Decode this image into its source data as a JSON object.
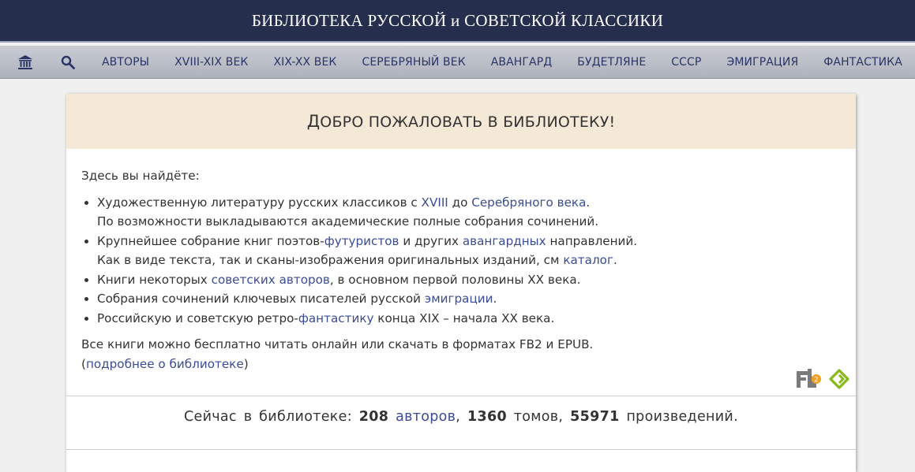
{
  "header": {
    "title": "БИБЛИОТЕКА РУССКОЙ и СОВЕТСКОЙ КЛАССИКИ"
  },
  "nav": {
    "home_icon": "library-building-icon",
    "search_icon": "search-icon",
    "items": [
      {
        "label": "АВТОРЫ"
      },
      {
        "label": "XVIII-XIX ВЕК"
      },
      {
        "label": "XIX-XX ВЕК"
      },
      {
        "label": "СЕРЕБРЯНЫЙ ВЕК"
      },
      {
        "label": "АВАНГАРД"
      },
      {
        "label": "БУДЕТЛЯНЕ"
      },
      {
        "label": "СССР"
      },
      {
        "label": "ЭМИГРАЦИЯ"
      },
      {
        "label": "ФАНТАСТИКА"
      }
    ]
  },
  "welcome": {
    "title_first": "Д",
    "title_rest": "ОБРО ПОЖАЛОВАТЬ В БИБЛИОТЕКУ!"
  },
  "intro": "Здесь вы найдёте:",
  "list": {
    "item1": {
      "a": "Художественную литературу русских классиков с ",
      "link1": "XVIII",
      "b": " до ",
      "link2": "Серебряного века",
      "c": ".",
      "line2": "По возможности выкладываются академические полные собрания сочинений."
    },
    "item2": {
      "a": "Крупнейшее собрание книг поэтов-",
      "link1": "футуристов",
      "b": " и других ",
      "link2": "авангардных",
      "c": " направлений.",
      "line2a": "Как в виде текста, так и сканы-изображения оригинальных изданий, см ",
      "link3": "каталог",
      "line2b": "."
    },
    "item3": {
      "a": "Книги некоторых ",
      "link1": "советских авторов",
      "b": ", в основном первой половины XX века."
    },
    "item4": {
      "a": "Собрания сочинений ключевых писателей русской ",
      "link1": "эмиграции",
      "b": "."
    },
    "item5": {
      "a": "Российскую и советскую ретро-",
      "link1": "фантастику",
      "b": " конца XIX – начала XX века."
    }
  },
  "footer_text": {
    "line1": "Все книги можно бесплатно читать онлайн или скачать в форматах FB2 и EPUB.",
    "open": "(",
    "link": "подробнее о библиотеке",
    "close": ")"
  },
  "formats": {
    "fb2_icon": "fb2-format-icon",
    "epub_icon": "epub-format-icon"
  },
  "stats": {
    "prefix": "Сейчас в библиотеке:",
    "authors_count": "208",
    "authors_link": "авторов",
    "sep1": ",",
    "volumes_count": "1360",
    "volumes_label": "томов,",
    "works_count": "55971",
    "works_label": "произведений."
  },
  "colors": {
    "header_bg": "#262e4d",
    "link": "#3a4c96",
    "welcome_bg": "#f4e8d6"
  }
}
